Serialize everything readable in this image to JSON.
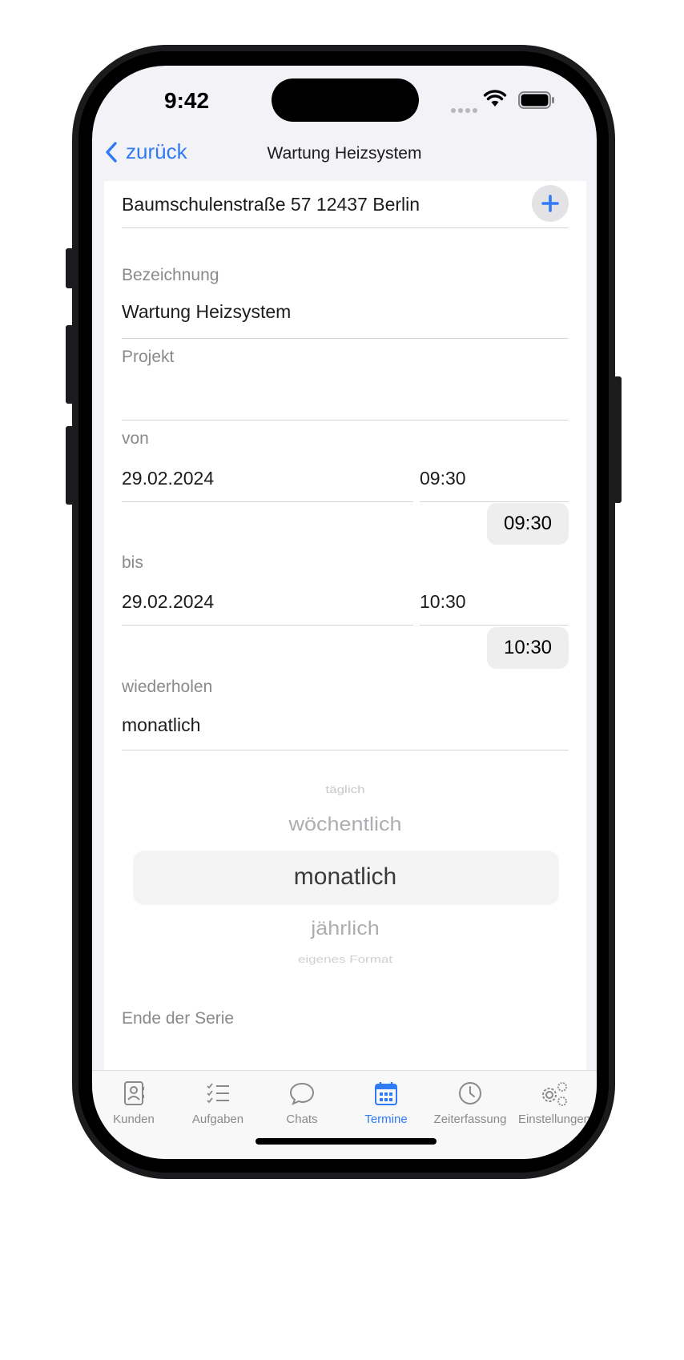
{
  "status_bar": {
    "time": "9:42"
  },
  "nav": {
    "back_label": "zurück",
    "title": "Wartung Heizsystem"
  },
  "form": {
    "address": "Baumschulenstraße 57 12437 Berlin",
    "designation_label": "Bezeichnung",
    "designation_value": "Wartung Heizsystem",
    "project_label": "Projekt",
    "project_value": "",
    "from_label": "von",
    "from_date": "29.02.2024",
    "from_time": "09:30",
    "from_time_chip": "09:30",
    "to_label": "bis",
    "to_date": "29.02.2024",
    "to_time": "10:30",
    "to_time_chip": "10:30",
    "repeat_label": "wiederholen",
    "repeat_value": "monatlich",
    "series_end_label": "Ende der Serie"
  },
  "picker": {
    "options": [
      "täglich",
      "wöchentlich",
      "monatlich",
      "jährlich",
      "eigenes Format"
    ],
    "selected": "monatlich"
  },
  "tabbar": {
    "items": [
      {
        "label": "Kunden",
        "icon": "contacts-icon"
      },
      {
        "label": "Aufgaben",
        "icon": "checklist-icon"
      },
      {
        "label": "Chats",
        "icon": "chat-bubble-icon"
      },
      {
        "label": "Termine",
        "icon": "calendar-icon"
      },
      {
        "label": "Zeiterfassung",
        "icon": "clock-icon"
      },
      {
        "label": "Einstellungen",
        "icon": "gears-icon"
      }
    ],
    "active": "Termine"
  },
  "colors": {
    "accent": "#2f7af5",
    "label_gray": "#8a8a8e",
    "background": "#f2f2f7"
  }
}
